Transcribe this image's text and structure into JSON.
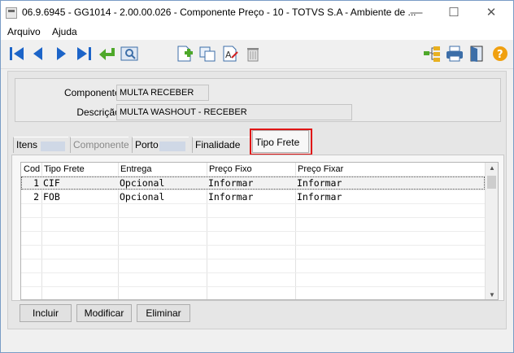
{
  "window": {
    "title": "06.9.6945 - GG1014 - 2.00.00.026 - Componente Preço - 10 - TOTVS S.A - Ambiente de ...",
    "minimize_glyph": "—",
    "maximize_glyph": "☐",
    "close_glyph": "✕"
  },
  "menu": {
    "items": [
      "Arquivo",
      "Ajuda"
    ]
  },
  "toolbar": {
    "icons": [
      "first-icon",
      "previous-icon",
      "next-icon",
      "last-icon",
      "back-icon",
      "preview-icon",
      "new-document-icon",
      "copy-icon",
      "edit-text-icon",
      "trash-icon",
      "tree-icon",
      "print-icon",
      "exit-door-icon",
      "help-icon"
    ]
  },
  "header": {
    "componente_label": "Componente:",
    "componente_value": "MULTA RECEBER",
    "descricao_label": "Descrição:",
    "descricao_value": "MULTA WASHOUT - RECEBER"
  },
  "tabs": [
    {
      "label": "Itens",
      "disabled": false
    },
    {
      "label": "Componentes",
      "disabled": true
    },
    {
      "label": "Porto",
      "disabled": false
    },
    {
      "label": "Finalidade",
      "disabled": false
    },
    {
      "label": "Tipo Frete",
      "active": true
    }
  ],
  "grid": {
    "columns": [
      "Cod",
      "Tipo Frete",
      "Entrega",
      "Preço Fixo",
      "Preço Fixar"
    ],
    "rows": [
      [
        "1",
        "CIF",
        "Opcional",
        "Informar",
        "Informar"
      ],
      [
        "2",
        "FOB",
        "Opcional",
        "Informar",
        "Informar"
      ]
    ]
  },
  "buttons": {
    "incluir": "Incluir",
    "modificar": "Modificar",
    "eliminar": "Eliminar"
  },
  "colors": {
    "highlight": "#e01515",
    "tab_tail": "#cfd8e6"
  }
}
